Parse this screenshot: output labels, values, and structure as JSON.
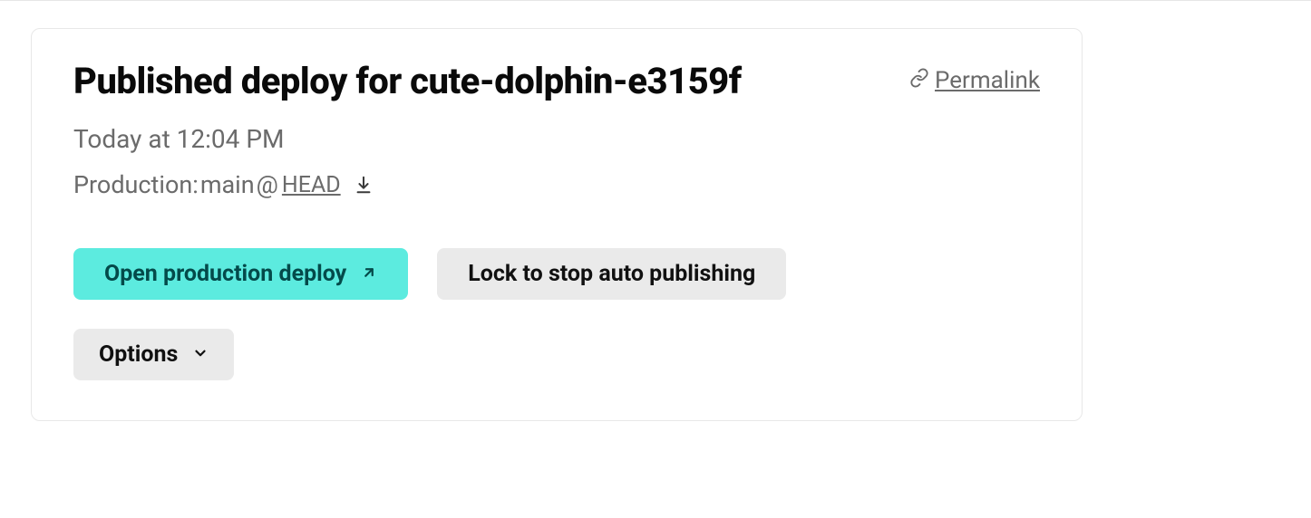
{
  "header": {
    "title": "Published deploy for cute-dolphin-e3159f",
    "permalink_label": "Permalink"
  },
  "meta": {
    "timestamp": "Today at 12:04 PM",
    "context_label": "Production: ",
    "branch": "main",
    "at_symbol": "@",
    "ref": "HEAD"
  },
  "actions": {
    "open_deploy_label": "Open production deploy",
    "lock_label": "Lock to stop auto publishing",
    "options_label": "Options"
  }
}
